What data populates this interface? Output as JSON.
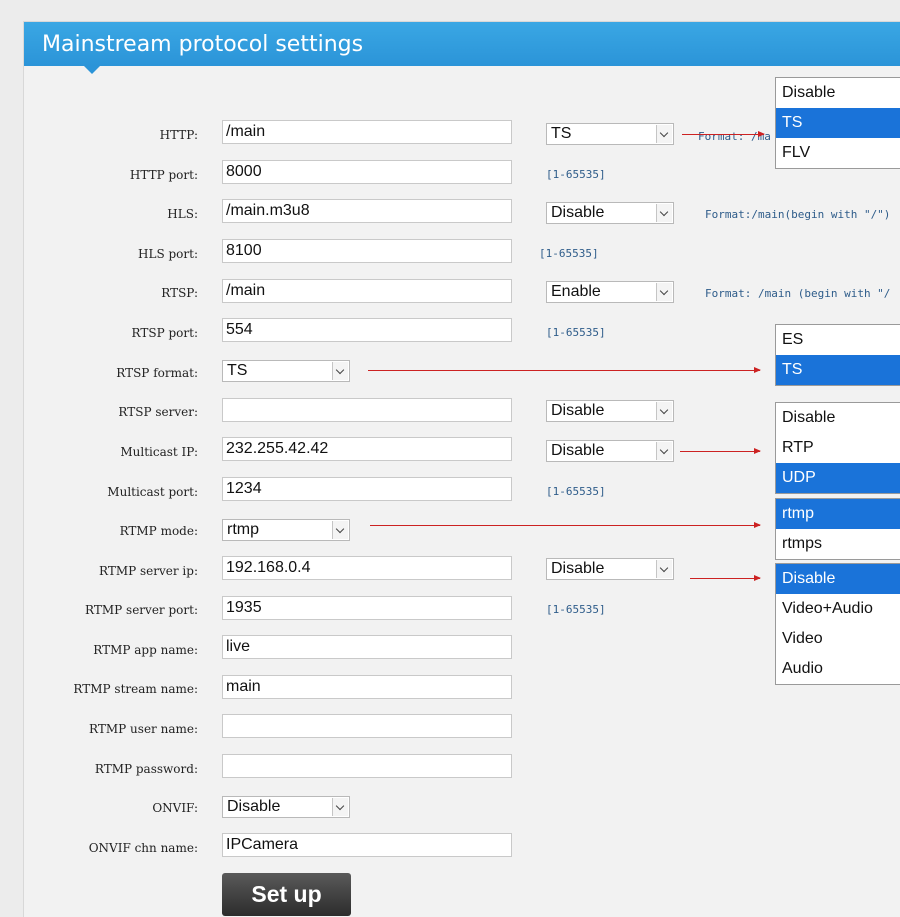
{
  "header": {
    "title": "Mainstream protocol settings"
  },
  "fields": {
    "http": {
      "label": "HTTP:",
      "value": "/main",
      "select": "TS",
      "hint": "Format: /ma"
    },
    "http_port": {
      "label": "HTTP port:",
      "value": "8000",
      "hint": "[1-65535]"
    },
    "hls": {
      "label": "HLS:",
      "value": "/main.m3u8",
      "select": "Disable",
      "hint": "Format:/main(begin with \"/\")"
    },
    "hls_port": {
      "label": "HLS port:",
      "value": "8100",
      "hint": "[1-65535]"
    },
    "rtsp": {
      "label": "RTSP:",
      "value": "/main",
      "select": "Enable",
      "hint": "Format: /main (begin with \"/"
    },
    "rtsp_port": {
      "label": "RTSP port:",
      "value": "554",
      "hint": "[1-65535]"
    },
    "rtsp_format": {
      "label": "RTSP format:",
      "select": "TS"
    },
    "rtsp_server": {
      "label": "RTSP server:",
      "value": "",
      "select": "Disable"
    },
    "multicast_ip": {
      "label": "Multicast IP:",
      "value": "232.255.42.42",
      "select": "Disable"
    },
    "multicast_port": {
      "label": "Multicast port:",
      "value": "1234",
      "hint": "[1-65535]"
    },
    "rtmp_mode": {
      "label": "RTMP mode:",
      "select": "rtmp"
    },
    "rtmp_server_ip": {
      "label": "RTMP server ip:",
      "value": "192.168.0.4",
      "select": "Disable"
    },
    "rtmp_server_port": {
      "label": "RTMP server port:",
      "value": "1935",
      "hint": "[1-65535]"
    },
    "rtmp_app_name": {
      "label": "RTMP app name:",
      "value": "live"
    },
    "rtmp_stream_name": {
      "label": "RTMP stream name:",
      "value": "main"
    },
    "rtmp_user_name": {
      "label": "RTMP user name:",
      "value": ""
    },
    "rtmp_password": {
      "label": "RTMP password:",
      "value": ""
    },
    "onvif": {
      "label": "ONVIF:",
      "select": "Disable"
    },
    "onvif_chn_name": {
      "label": "ONVIF chn name:",
      "value": "IPCamera"
    }
  },
  "dropdowns": {
    "http_format": [
      "Disable",
      "TS",
      "FLV"
    ],
    "rtsp_format": [
      "ES",
      "TS"
    ],
    "multicast": [
      "Disable",
      "RTP",
      "UDP"
    ],
    "rtmp_mode": [
      "rtmp",
      "rtmps"
    ],
    "rtmp_server": [
      "Disable",
      "Video+Audio",
      "Video",
      "Audio"
    ]
  },
  "button": {
    "setup": "Set up"
  },
  "colors": {
    "header": "#2b94d8",
    "selected_option": "#1a73d9",
    "arrow": "#cc2222"
  }
}
